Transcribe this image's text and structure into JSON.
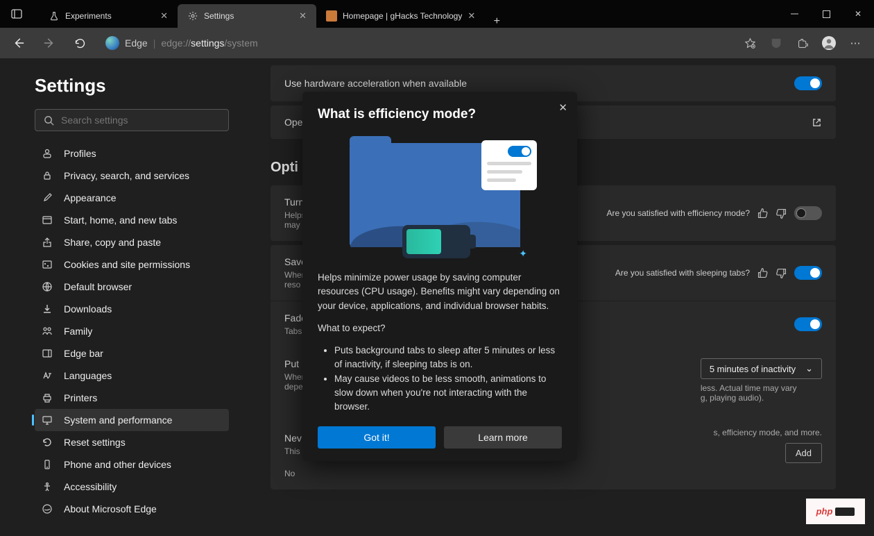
{
  "tabs": [
    {
      "label": "Experiments"
    },
    {
      "label": "Settings"
    },
    {
      "label": "Homepage | gHacks Technology"
    }
  ],
  "addr": {
    "brand": "Edge",
    "prefix": "edge://",
    "mid": "settings",
    "suffix": "/system"
  },
  "sidebar": {
    "title": "Settings",
    "search_ph": "Search settings",
    "items": [
      {
        "ico": "person",
        "label": "Profiles"
      },
      {
        "ico": "lock",
        "label": "Privacy, search, and services"
      },
      {
        "ico": "brush",
        "label": "Appearance"
      },
      {
        "ico": "home",
        "label": "Start, home, and new tabs"
      },
      {
        "ico": "share",
        "label": "Share, copy and paste"
      },
      {
        "ico": "cookie",
        "label": "Cookies and site permissions"
      },
      {
        "ico": "browser",
        "label": "Default browser"
      },
      {
        "ico": "download",
        "label": "Downloads"
      },
      {
        "ico": "family",
        "label": "Family"
      },
      {
        "ico": "bar",
        "label": "Edge bar"
      },
      {
        "ico": "lang",
        "label": "Languages"
      },
      {
        "ico": "printer",
        "label": "Printers"
      },
      {
        "ico": "system",
        "label": "System and performance",
        "sel": true
      },
      {
        "ico": "reset",
        "label": "Reset settings"
      },
      {
        "ico": "phone",
        "label": "Phone and other devices"
      },
      {
        "ico": "access",
        "label": "Accessibility"
      },
      {
        "ico": "edge",
        "label": "About Microsoft Edge"
      }
    ]
  },
  "main": {
    "hw": "Use hardware acceleration when available",
    "open_proxy": "Ope",
    "section": "Opti",
    "rows": [
      {
        "t": "Turn",
        "s": "Helps minimize",
        "s2": "may"
      },
      {
        "t": "Save",
        "s": "When",
        "s2": "reso"
      },
      {
        "t": "Fade",
        "s": "Tabs"
      },
      {
        "t": "Put",
        "s": "When",
        "s2": "depe"
      },
      {
        "t": "Nev",
        "s": "This",
        "s2": "No"
      }
    ],
    "sat1": "Are you satisfied with efficiency mode?",
    "sat2": "Are you satisfied with sleeping tabs?",
    "row3_tail": "less. Actual time may vary",
    "row3_tail2": "g, playing audio).",
    "row4_tail": "s, efficiency mode, and more.",
    "dropdown": "5 minutes of inactivity",
    "add": "Add"
  },
  "modal": {
    "title": "What is efficiency mode?",
    "p1": "Helps minimize power usage by saving computer resources (CPU usage). Benefits might vary depending on your device, applications, and individual browser habits.",
    "p2": "What to expect?",
    "li1": "Puts background tabs to sleep after 5 minutes or less of inactivity, if sleeping tabs is on.",
    "li2": "May cause videos to be less smooth, animations to slow down when you're not interacting with the browser.",
    "gotit": "Got it!",
    "learn": "Learn more"
  },
  "wm": "php"
}
